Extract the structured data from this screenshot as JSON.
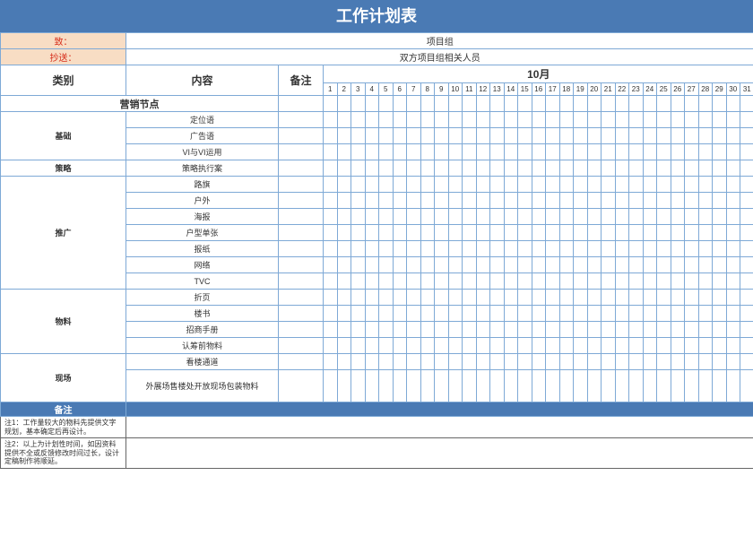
{
  "title": "工作计划表",
  "to_label": "致：",
  "to_value": "项目组",
  "cc_label": "抄送：",
  "cc_value": "双方项目组相关人员",
  "header_category": "类别",
  "header_content": "内容",
  "header_remark": "备注",
  "month_label": "10月",
  "days": [
    1,
    2,
    3,
    4,
    5,
    6,
    7,
    8,
    9,
    10,
    11,
    12,
    13,
    14,
    15,
    16,
    17,
    18,
    19,
    20,
    21,
    22,
    23,
    24,
    25,
    26,
    27,
    28,
    29,
    30,
    31
  ],
  "section_label": "营销节点",
  "groups": [
    {
      "name": "基础",
      "items": [
        "定位语",
        "广告语",
        "VI与VI运用"
      ]
    },
    {
      "name": "策略",
      "items": [
        "策略执行案"
      ]
    },
    {
      "name": "推广",
      "items": [
        "路旗",
        "户外",
        "海报",
        "户型单张",
        "报纸",
        "网络",
        "TVC"
      ]
    },
    {
      "name": "物料",
      "items": [
        "折页",
        "楼书",
        "招商手册",
        "认筹前物料"
      ]
    },
    {
      "name": "现场",
      "items": [
        "看楼通道",
        "外展场售楼处开放现场包装物料"
      ]
    }
  ],
  "footer_remark_label": "备注",
  "note1": "注1：工作量较大的物料先提供文字规划，基本确定后再设计。",
  "note2": "注2：以上为计划性时间，如因资料提供不全或反馈修改时间过长，设计定稿制作将顺延。"
}
